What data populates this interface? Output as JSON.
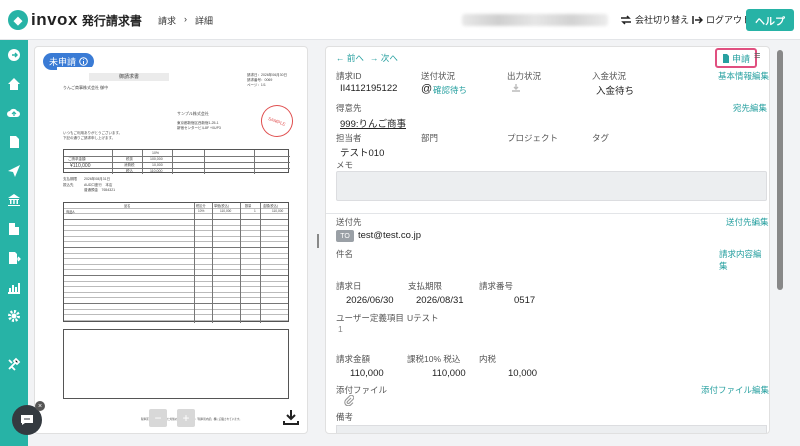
{
  "header": {
    "brand": "invox",
    "brand_sub": "発行請求書",
    "breadcrumb_1": "請求",
    "breadcrumb_sep": "›",
    "breadcrumb_2": "詳細",
    "switch_company": "会社切り替え",
    "logout": "ログアウト",
    "help": "ヘルプ"
  },
  "nav": {
    "items": [
      "arrow-right-icon",
      "home-icon",
      "cloud-upload-icon",
      "document-icon",
      "send-icon",
      "bank-icon",
      "building-icon",
      "document-export-icon",
      "chart-icon",
      "gear-icon",
      "tools-icon"
    ]
  },
  "preview": {
    "status": "未申請",
    "title": "御請求書",
    "customer": "りんご商事株式会社 御中",
    "meta": "請求日：2026年06月30日\n請求番号：0069\nページ：1/1",
    "sender": "サンプル株式会社",
    "sender_addr": "東京都新宿区西新宿1-25-1\n新宿センタービル8F +0UP3",
    "greeting": "いつもご利用ありがとうございます。\n下記の通りご請求申し上げます。",
    "amount_label": "ご請求金額",
    "amount": "¥110,000",
    "rate": "10%",
    "tax_label_1": "税抜",
    "tax_val_1": "100,000",
    "tax_label_2": "消費税",
    "tax_val_2": "10,000",
    "tax_label_3": "税込",
    "tax_val_3": "110,000",
    "due": "支払期限　　2026年08月31日",
    "bank": "振込先　　　AUD口座行　本店\n　　　　　　普通預金　7654321",
    "col_item": "品名",
    "col_rate": "税区分",
    "col_price": "単価(税込)",
    "col_qty": "数量",
    "col_amount": "金額(税込)",
    "row_item": "商品A",
    "row_rate": "10%",
    "row_price": "110,000",
    "row_qty": "1",
    "row_amount": "110,000",
    "stamp": "SAMPLE",
    "footer": "税率区分ごとに合計した対価の額は本請求書の「税率別内訳」欄に記載されています。",
    "zoom_out": "−",
    "zoom_in": "+"
  },
  "detail": {
    "prev": "前へ",
    "next": "次へ",
    "apply": "申請",
    "invoice_id_label": "請求ID",
    "invoice_id": "II4112195122",
    "send_status_label": "送付状況",
    "send_status": "確認待ち",
    "output_status_label": "出力状況",
    "payment_status_label": "入金状況",
    "payment_status": "入金待ち",
    "edit_basic": "基本情報編集",
    "customer_label": "得意先",
    "customer": "999:りんご商事",
    "edit_destination": "宛先編集",
    "staff_label": "担当者",
    "staff": "テスト010",
    "dept_label": "部門",
    "project_label": "プロジェクト",
    "tag_label": "タグ",
    "memo_label": "メモ",
    "sendto_label": "送付先",
    "edit_sendto": "送付先編集",
    "to_badge": "TO",
    "email": "test@test.co.jp",
    "subject_label": "件名",
    "edit_content": "請求内容編集",
    "invoice_date_label": "請求日",
    "invoice_date": "2026/06/30",
    "due_label": "支払期限",
    "due": "2026/08/31",
    "invoice_no_label": "請求番号",
    "invoice_no": "0517",
    "custom_label": "ユーザー定義項目",
    "custom_name": "Uテスト",
    "custom_value": "1",
    "amount_label": "請求金額",
    "amount": "110,000",
    "tax_label": "課税10% 税込",
    "tax_amount": "110,000",
    "inner_tax_label": "内税",
    "inner_tax": "10,000",
    "attach_label": "添付ファイル",
    "edit_attach": "添付ファイル編集",
    "remarks_label": "備考"
  }
}
